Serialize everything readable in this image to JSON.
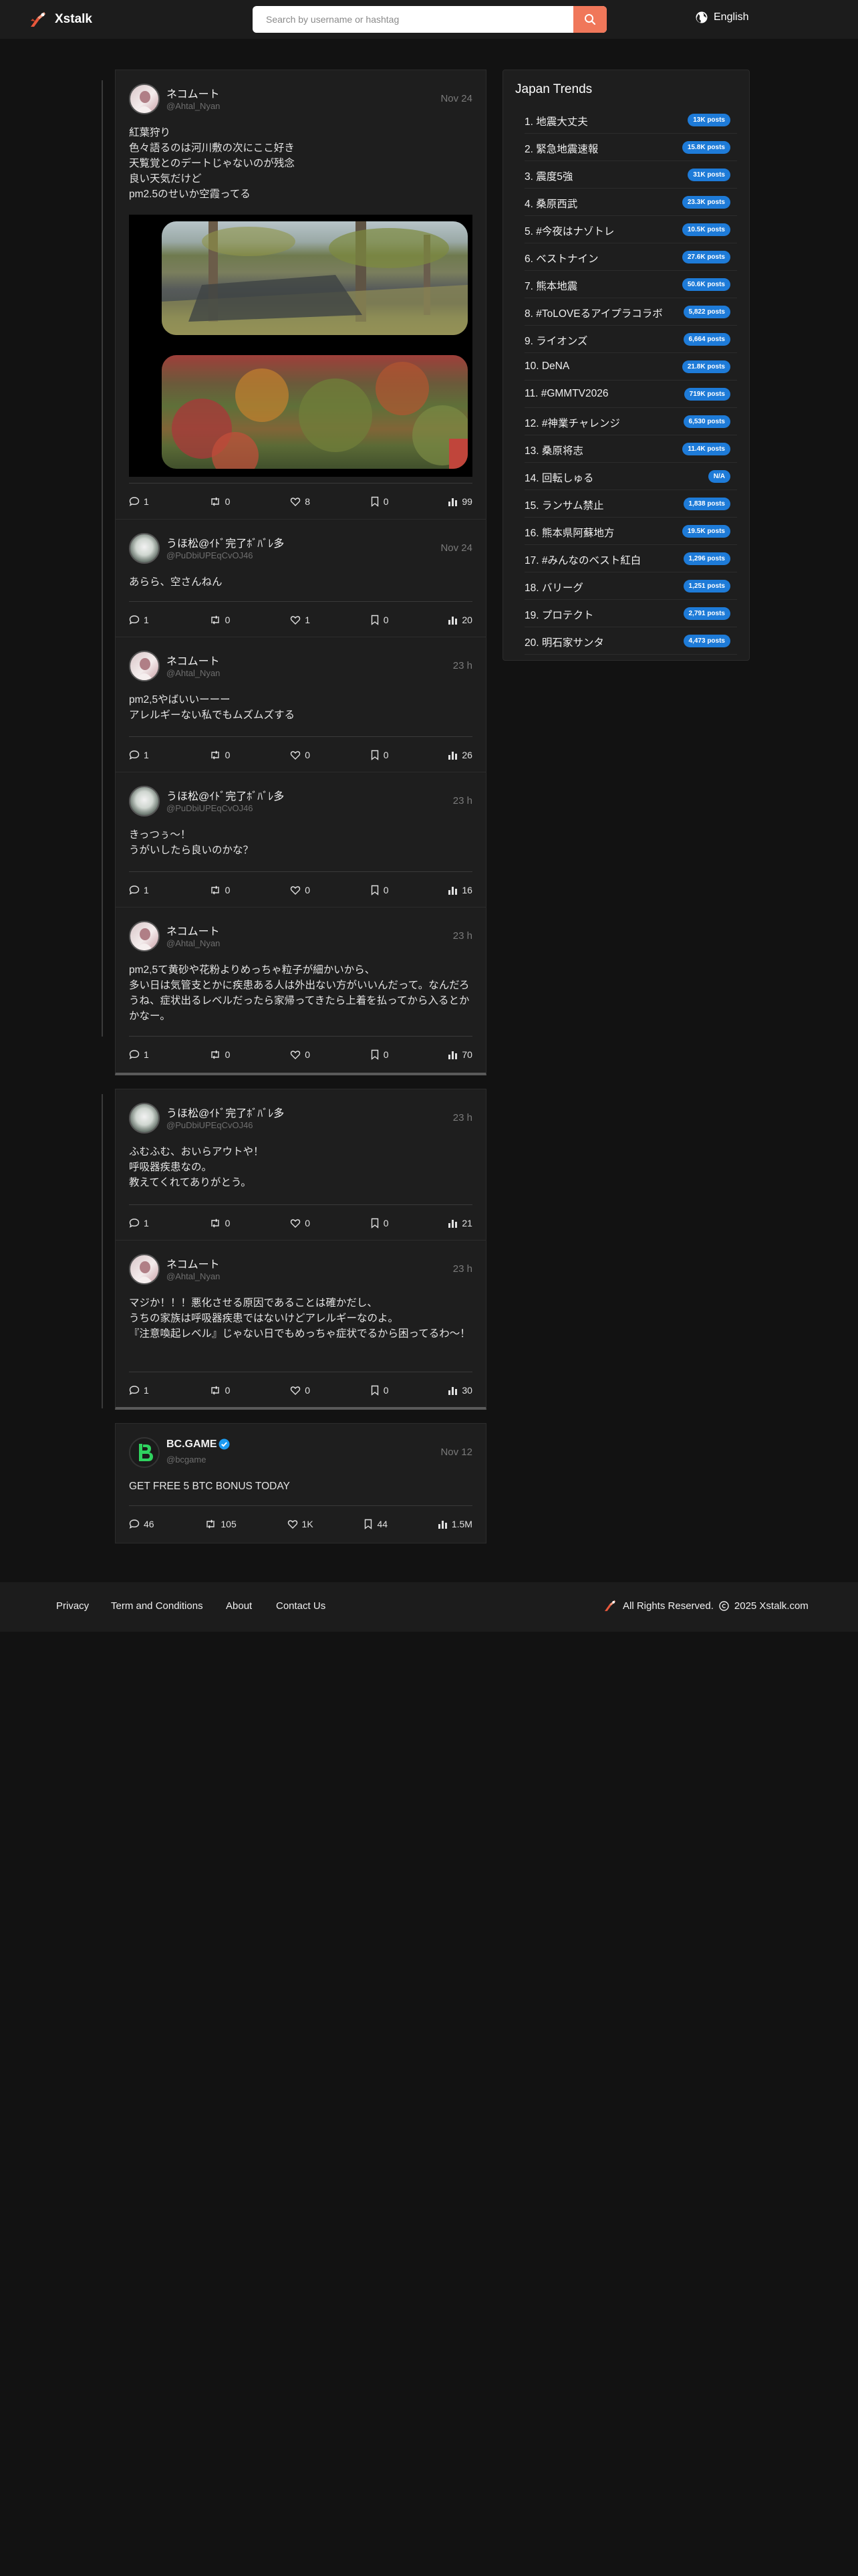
{
  "header": {
    "logo_text": "Xstalk",
    "search_placeholder": "Search by username or hashtag",
    "language": "English"
  },
  "threads": [
    {
      "posts": [
        {
          "name": "ネコムート",
          "handle": "@Ahtal_Nyan",
          "time": "Nov 24",
          "text": "紅葉狩り\n色々語るのは河川敷の次にここ好き\n天覧覚とのデートじゃないのが残念\n良い天気だけど\npm2.5のせいか空霞ってる",
          "stats": {
            "comments": "1",
            "reposts": "0",
            "likes": "8",
            "bookmarks": "0",
            "views": "99"
          }
        },
        {
          "name": "うほ松@ｲﾄﾞ完了ﾎﾞﾊﾞﾚ多",
          "handle": "@PuDbiUPEqCvOJ46",
          "time": "Nov 24",
          "text": "あらら、空さんねん",
          "stats": {
            "comments": "1",
            "reposts": "0",
            "likes": "1",
            "bookmarks": "0",
            "views": "20"
          }
        },
        {
          "name": "ネコムート",
          "handle": "@Ahtal_Nyan",
          "time": "23 h",
          "text": "pm2,5やばいいーーー\nアレルギーない私でもムズムズする",
          "stats": {
            "comments": "1",
            "reposts": "0",
            "likes": "0",
            "bookmarks": "0",
            "views": "26"
          }
        },
        {
          "name": "うほ松@ｲﾄﾞ完了ﾎﾞﾊﾞﾚ多",
          "handle": "@PuDbiUPEqCvOJ46",
          "time": "23 h",
          "text": "きっつぅ〜！\nうがいしたら良いのかな？",
          "stats": {
            "comments": "1",
            "reposts": "0",
            "likes": "0",
            "bookmarks": "0",
            "views": "16"
          }
        },
        {
          "name": "ネコムート",
          "handle": "@Ahtal_Nyan",
          "time": "23 h",
          "text": "pm2,5て黄砂や花粉よりめっちゃ粒子が細かいから、\n多い日は気管支とかに疾患ある人は外出ない方がいいんだって。なんだろうね、症状出るレベルだったら家帰ってきたら上着を払ってから入るとかかなー。",
          "stats": {
            "comments": "1",
            "reposts": "0",
            "likes": "0",
            "bookmarks": "0",
            "views": "70"
          }
        }
      ]
    },
    {
      "posts": [
        {
          "name": "うほ松@ｲﾄﾞ完了ﾎﾞﾊﾞﾚ多",
          "handle": "@PuDbiUPEqCvOJ46",
          "time": "23 h",
          "text": "ふむふむ、おいらアウトや！\n呼吸器疾患なの。\n教えてくれてありがとう。",
          "stats": {
            "comments": "1",
            "reposts": "0",
            "likes": "0",
            "bookmarks": "0",
            "views": "21"
          }
        },
        {
          "name": "ネコムート",
          "handle": "@Ahtal_Nyan",
          "time": "23 h",
          "text": "マジか！！！悪化させる原因であることは確かだし、\nうちの家族は呼吸器疾患ではないけどアレルギーなのよ。\n『注意喚起レベル』じゃない日でもめっちゃ症状でるから困ってるわ〜！",
          "stats": {
            "comments": "1",
            "reposts": "0",
            "likes": "0",
            "bookmarks": "0",
            "views": "30"
          }
        }
      ]
    },
    {
      "posts": [
        {
          "name": "BC.GAME",
          "handle": "@bcgame",
          "time": "Nov 12",
          "verified": true,
          "text": "GET FREE 5 BTC BONUS TODAY",
          "stats": {
            "comments": "46",
            "reposts": "105",
            "likes": "1K",
            "bookmarks": "44",
            "views": "1.5M"
          }
        }
      ]
    }
  ],
  "trends": {
    "title": "Japan Trends",
    "items": [
      {
        "label": "1. 地震大丈夫",
        "badge": "13K posts"
      },
      {
        "label": "2. 緊急地震速報",
        "badge": "15.8K posts"
      },
      {
        "label": "3. 震度5強",
        "badge": "31K posts"
      },
      {
        "label": "4. 桑原西武",
        "badge": "23.3K posts"
      },
      {
        "label": "5. #今夜はナゾトレ",
        "badge": "10.5K posts"
      },
      {
        "label": "6. ベストナイン",
        "badge": "27.6K posts"
      },
      {
        "label": "7. 熊本地震",
        "badge": "50.6K posts"
      },
      {
        "label": "8. #ToLOVEるアイプラコラボ",
        "badge": "5,822 posts"
      },
      {
        "label": "9. ライオンズ",
        "badge": "6,664 posts"
      },
      {
        "label": "10. DeNA",
        "badge": "21.8K posts"
      },
      {
        "label": "11. #GMMTV2026",
        "badge": "719K posts"
      },
      {
        "label": "12. #神業チャレンジ",
        "badge": "6,530 posts"
      },
      {
        "label": "13. 桑原将志",
        "badge": "11.4K posts"
      },
      {
        "label": "14. 回転しゅる",
        "badge": "N/A"
      },
      {
        "label": "15. ランサム禁止",
        "badge": "1,838 posts"
      },
      {
        "label": "16. 熊本県阿蘇地方",
        "badge": "19.5K posts"
      },
      {
        "label": "17. #みんなのベスト紅白",
        "badge": "1,296 posts"
      },
      {
        "label": "18. バリーグ",
        "badge": "1,251 posts"
      },
      {
        "label": "19. プロテクト",
        "badge": "2,791 posts"
      },
      {
        "label": "20. 明石家サンタ",
        "badge": "4,473 posts"
      }
    ]
  },
  "footer": {
    "links": [
      "Privacy",
      "Term and Conditions",
      "About",
      "Contact Us"
    ],
    "rights_text": "All Rights Reserved.",
    "copyright_text": "2025 Xstalk.com"
  },
  "colors": {
    "background": "#121212",
    "panel": "#1e1e1e",
    "accent": "#f0775a",
    "badge": "#1e7bd8",
    "verified": "#1d9bf0"
  }
}
